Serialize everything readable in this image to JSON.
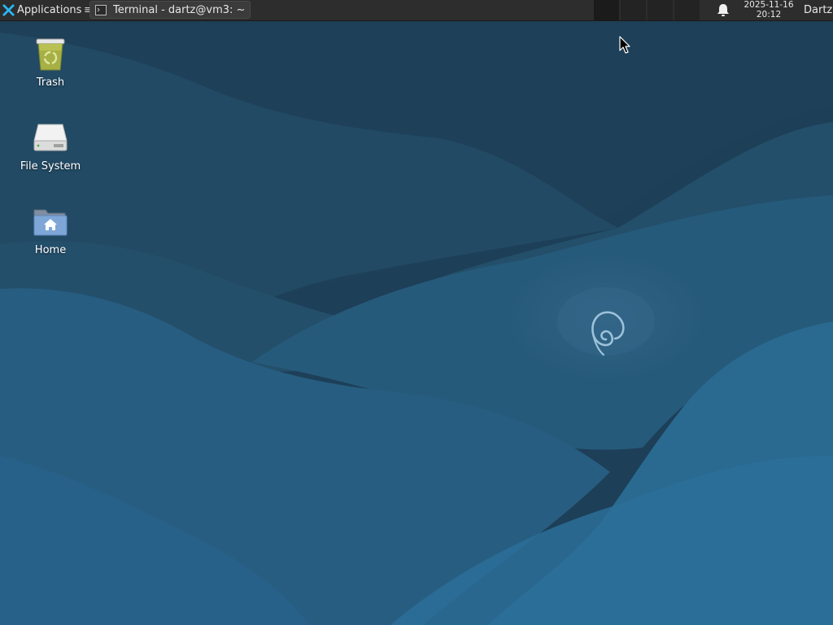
{
  "panel": {
    "apps_label": "Applications",
    "apps_separator": "≡",
    "task": {
      "label": "Terminal - dartz@vm3: ~",
      "icon": "terminal-icon"
    },
    "clock": {
      "date": "2025-11-16",
      "time": "20:12"
    },
    "user": "Dartz",
    "notification_icon": "bell-icon"
  },
  "desktop": {
    "icons": [
      {
        "label": "Trash",
        "icon": "trash-icon"
      },
      {
        "label": "File System",
        "icon": "drive-icon"
      },
      {
        "label": "Home",
        "icon": "home-folder-icon"
      }
    ]
  },
  "colors": {
    "panel_bg": "#2d2d2d",
    "wallpaper_dark": "#1f4560",
    "wallpaper_light": "#276a94",
    "accent": "#29b6f6"
  }
}
